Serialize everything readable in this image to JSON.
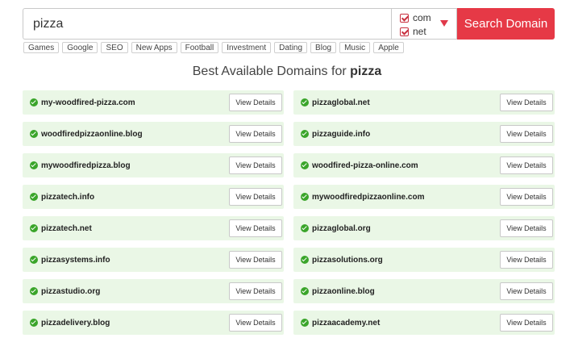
{
  "search": {
    "query": "pizza",
    "button_label": "Search Domain"
  },
  "tlds": [
    {
      "label": "com",
      "checked": true
    },
    {
      "label": "net",
      "checked": true
    }
  ],
  "tags": [
    "Games",
    "Google",
    "SEO",
    "New Apps",
    "Football",
    "Investment",
    "Dating",
    "Blog",
    "Music",
    "Apple"
  ],
  "heading": {
    "prefix": "Best Available Domains for ",
    "term": "pizza"
  },
  "details_label": "View Details",
  "domains": [
    "my-woodfired-pizza.com",
    "pizzaglobal.net",
    "woodfiredpizzaonline.blog",
    "pizzaguide.info",
    "mywoodfiredpizza.blog",
    "woodfired-pizza-online.com",
    "pizzatech.info",
    "mywoodfiredpizzaonline.com",
    "pizzatech.net",
    "pizzaglobal.org",
    "pizzasystems.info",
    "pizzasolutions.org",
    "pizzastudio.org",
    "pizzaonline.blog",
    "pizzadelivery.blog",
    "pizzaacademy.net"
  ],
  "colors": {
    "accent": "#e63946",
    "available_bg": "#eaf7e6",
    "available_icon": "#3aa52a"
  }
}
